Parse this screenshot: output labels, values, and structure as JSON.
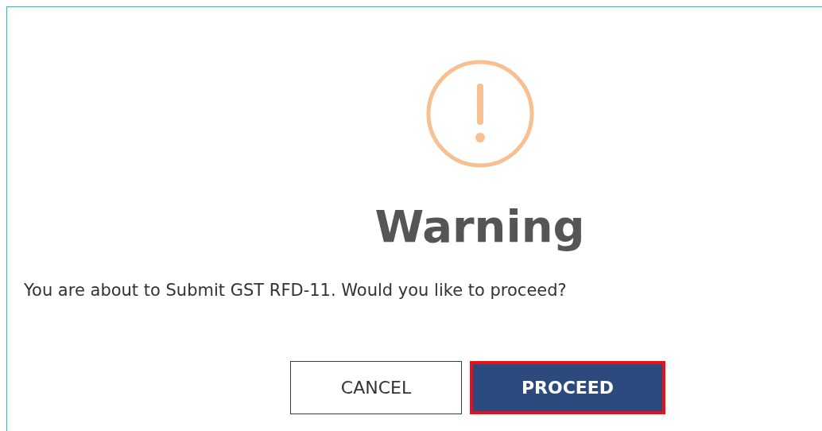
{
  "dialog": {
    "title": "Warning",
    "message": "You are about to Submit GST RFD-11. Would you like to proceed?",
    "buttons": [
      {
        "label": "CANCEL",
        "kind": "secondary",
        "highlighted": false
      },
      {
        "label": "PROCEED",
        "kind": "primary",
        "highlighted": true
      }
    ]
  }
}
